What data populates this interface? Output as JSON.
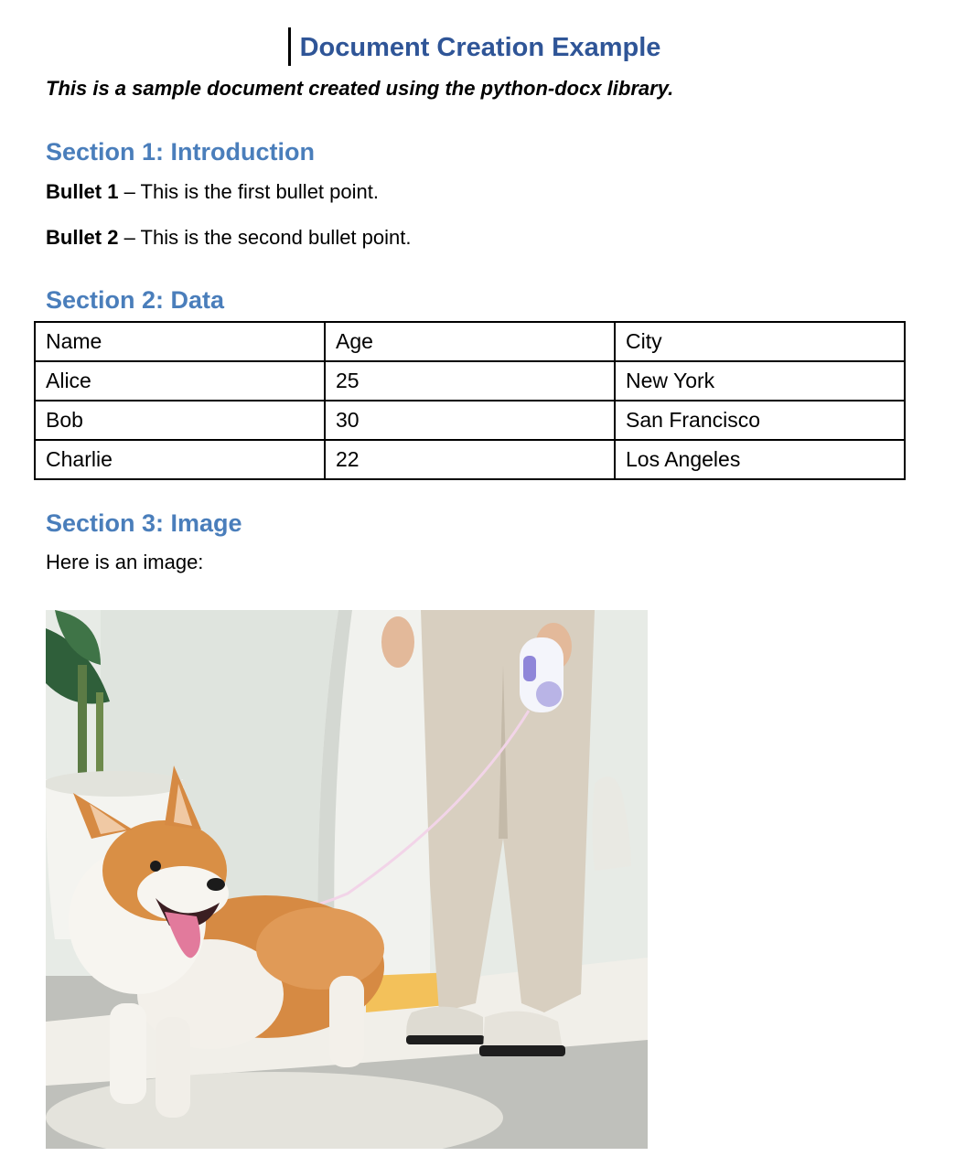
{
  "document": {
    "title": "Document Creation Example",
    "subtitle": "This is a sample document created using the python-docx library."
  },
  "section1": {
    "heading": "Section 1: Introduction",
    "bullets": [
      {
        "label": "Bullet 1",
        "separator": " – ",
        "text": "This is the first bullet point."
      },
      {
        "label": "Bullet 2",
        "separator": " – ",
        "text": "This is the second bullet point."
      }
    ]
  },
  "section2": {
    "heading": "Section 2: Data",
    "table": {
      "headers": [
        "Name",
        "Age",
        "City"
      ],
      "rows": [
        [
          "Alice",
          "25",
          "New York"
        ],
        [
          "Bob",
          "30",
          "San Francisco"
        ],
        [
          "Charlie",
          "22",
          "Los Angeles"
        ]
      ]
    }
  },
  "section3": {
    "heading": "Section 3: Image",
    "intro": "Here is an image:",
    "image_subject": "corgi-on-leash-photo"
  },
  "colors": {
    "title": "#2F5597",
    "heading": "#4A7EBB",
    "text": "#000000",
    "table_border": "#000000"
  }
}
